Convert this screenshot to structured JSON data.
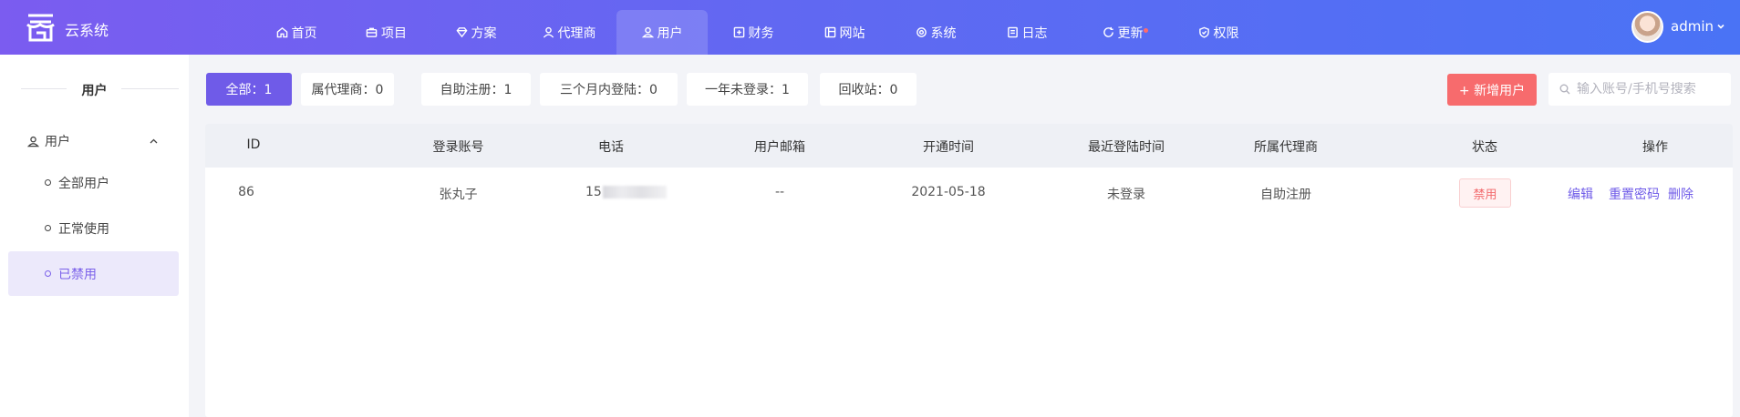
{
  "header": {
    "brand": "云系统",
    "nav": [
      {
        "label": "首页",
        "icon": "home-icon"
      },
      {
        "label": "项目",
        "icon": "briefcase-icon"
      },
      {
        "label": "方案",
        "icon": "diamond-icon"
      },
      {
        "label": "代理商",
        "icon": "user-icon"
      },
      {
        "label": "用户",
        "icon": "users-icon",
        "active": true
      },
      {
        "label": "财务",
        "icon": "finance-icon"
      },
      {
        "label": "网站",
        "icon": "website-icon"
      },
      {
        "label": "系统",
        "icon": "settings-icon"
      },
      {
        "label": "日志",
        "icon": "log-icon"
      },
      {
        "label": "更新",
        "icon": "refresh-icon",
        "badge_dot": true
      },
      {
        "label": "权限",
        "icon": "shield-icon"
      }
    ],
    "user": {
      "name": "admin"
    }
  },
  "sidebar": {
    "title": "用户",
    "group": {
      "label": "用户",
      "expanded": true
    },
    "items": [
      {
        "label": "全部用户"
      },
      {
        "label": "正常使用"
      },
      {
        "label": "已禁用",
        "active": true
      }
    ]
  },
  "filters": [
    {
      "label": "全部：1",
      "active": true
    },
    {
      "label": "属代理商：0"
    },
    {
      "label": "自助注册：1"
    },
    {
      "label": "三个月内登陆：0"
    },
    {
      "label": "一年未登录：1"
    },
    {
      "label": "回收站：0"
    }
  ],
  "actions": {
    "add_user": "+ 新增用户"
  },
  "search": {
    "placeholder": "输入账号/手机号搜索",
    "value": ""
  },
  "table": {
    "columns": [
      "ID",
      "登录账号",
      "电话",
      "用户邮箱",
      "开通时间",
      "最近登陆时间",
      "所属代理商",
      "状态",
      "操作"
    ],
    "rows": [
      {
        "id": "86",
        "account": "张丸子",
        "phone_visible": "15",
        "email": "--",
        "opened": "2021-05-18",
        "last_login": "未登录",
        "agent": "自助注册",
        "status": "禁用",
        "ops": [
          "编辑",
          "重置密码",
          "删除"
        ]
      }
    ]
  },
  "colors": {
    "accent": "#6f5be8",
    "danger": "#f76b6d",
    "header_start": "#7b5cf0",
    "header_end": "#4a73f5"
  }
}
